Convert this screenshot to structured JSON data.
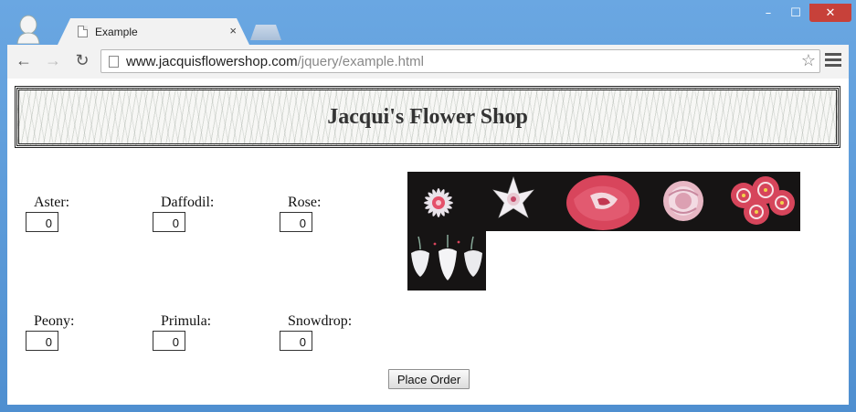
{
  "browser": {
    "tab_title": "Example",
    "tab_close": "×",
    "url_host": "www.jacquisflowershop.com",
    "url_path": "/jquery/example.html",
    "minimize": "–",
    "maximize": "☐",
    "close": "✕",
    "back": "←",
    "forward": "→",
    "reload": "↻",
    "star": "☆"
  },
  "page": {
    "title": "Jacqui's Flower Shop",
    "flowers": [
      {
        "label": "Aster:",
        "quantity": "0"
      },
      {
        "label": "Daffodil:",
        "quantity": "0"
      },
      {
        "label": "Rose:",
        "quantity": "0"
      },
      {
        "label": "Peony:",
        "quantity": "0"
      },
      {
        "label": "Primula:",
        "quantity": "0"
      },
      {
        "label": "Snowdrop:",
        "quantity": "0"
      }
    ],
    "images": [
      "aster-image",
      "daffodil-image",
      "rose-image",
      "peony-image",
      "primula-image",
      "snowdrop-image"
    ],
    "order_button": "Place Order"
  },
  "colors": {
    "window_frame": "#5a9ad6",
    "close_button": "#c7413a",
    "image_background": "#161414"
  }
}
